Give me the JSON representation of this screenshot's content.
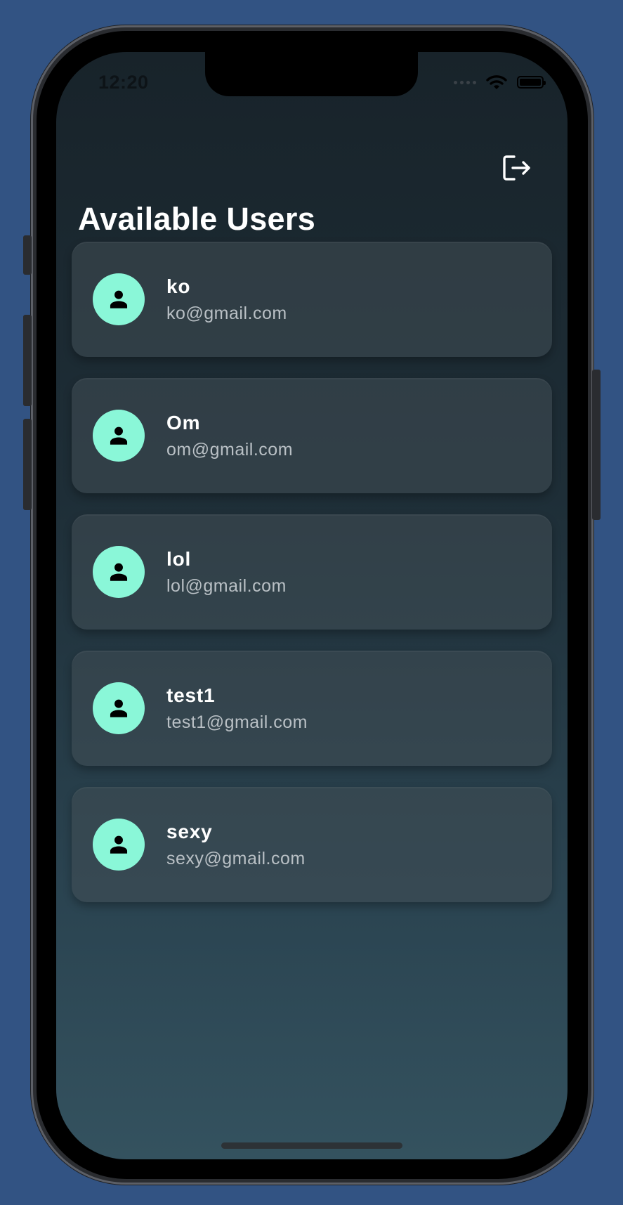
{
  "status_bar": {
    "time": "12:20"
  },
  "header": {
    "title": "Available Users",
    "logout_icon": "logout-icon"
  },
  "users": [
    {
      "name": "ko",
      "email": "ko@gmail.com"
    },
    {
      "name": "Om",
      "email": "om@gmail.com"
    },
    {
      "name": "lol",
      "email": "lol@gmail.com"
    },
    {
      "name": "test1",
      "email": "test1@gmail.com"
    },
    {
      "name": "sexy",
      "email": "sexy@gmail.com"
    }
  ],
  "colors": {
    "background": "#325383",
    "avatar": "#8af7d8",
    "card": "#3a464e",
    "title": "#ffffff",
    "email": "#b9c0c5"
  }
}
